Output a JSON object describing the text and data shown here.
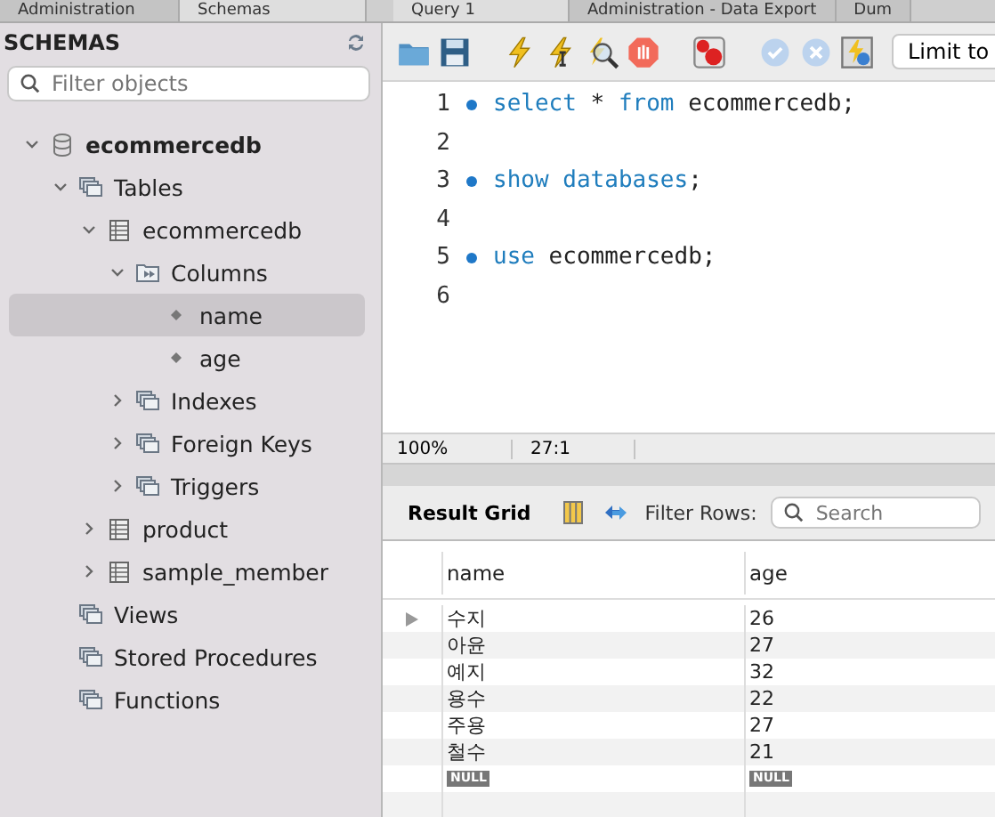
{
  "top_tabs": [
    {
      "label": "Administration",
      "selected": false
    },
    {
      "label": "Schemas",
      "selected": true
    },
    {
      "label": "Query 1",
      "selected": true
    },
    {
      "label": "Administration - Data Export",
      "selected": false
    },
    {
      "label": "Dum",
      "selected": false
    }
  ],
  "sidebar": {
    "title": "SCHEMAS",
    "filter": {
      "placeholder": "Filter objects"
    },
    "tree": [
      {
        "label": "ecommercedb",
        "kind": "database",
        "expanded": true,
        "selected": false,
        "children": [
          {
            "label": "Tables",
            "kind": "folder",
            "expanded": true,
            "selected": false,
            "children": [
              {
                "label": "ecommercedb",
                "kind": "table",
                "expanded": true,
                "selected": false,
                "children": [
                  {
                    "label": "Columns",
                    "kind": "columns",
                    "expanded": true,
                    "selected": false,
                    "children": [
                      {
                        "label": "name",
                        "kind": "column",
                        "selected": true
                      },
                      {
                        "label": "age",
                        "kind": "column",
                        "selected": false
                      }
                    ]
                  },
                  {
                    "label": "Indexes",
                    "kind": "folder",
                    "expanded": false,
                    "selected": false
                  },
                  {
                    "label": "Foreign Keys",
                    "kind": "folder",
                    "expanded": false,
                    "selected": false
                  },
                  {
                    "label": "Triggers",
                    "kind": "folder",
                    "expanded": false,
                    "selected": false
                  }
                ]
              },
              {
                "label": "product",
                "kind": "table",
                "expanded": false,
                "selected": false
              },
              {
                "label": "sample_member",
                "kind": "table",
                "expanded": false,
                "selected": false
              }
            ]
          },
          {
            "label": "Views",
            "kind": "folder",
            "selected": false
          },
          {
            "label": "Stored Procedures",
            "kind": "folder",
            "selected": false
          },
          {
            "label": "Functions",
            "kind": "folder",
            "selected": false
          }
        ]
      }
    ]
  },
  "toolbar": {
    "limit": "Limit to"
  },
  "editor": {
    "lines": [
      {
        "number": "1",
        "marker": true,
        "tokens": [
          {
            "text": "select",
            "kind": "keyword"
          },
          {
            "text": " * ",
            "kind": "plain"
          },
          {
            "text": "from",
            "kind": "keyword"
          },
          {
            "text": " ecommercedb;",
            "kind": "plain"
          }
        ]
      },
      {
        "number": "2",
        "marker": false
      },
      {
        "number": "3",
        "marker": true,
        "tokens": [
          {
            "text": "show",
            "kind": "keyword"
          },
          {
            "text": " databases",
            "kind": "keyword"
          },
          {
            "text": ";",
            "kind": "plain"
          }
        ]
      },
      {
        "number": "4",
        "marker": false
      },
      {
        "number": "5",
        "marker": true,
        "tokens": [
          {
            "text": "use",
            "kind": "keyword"
          },
          {
            "text": " ecommercedb;",
            "kind": "plain"
          }
        ]
      },
      {
        "number": "6",
        "marker": false
      }
    ]
  },
  "status": {
    "zoom": "100%",
    "position": "27:1"
  },
  "result": {
    "title": "Result Grid",
    "filter_label": "Filter Rows:",
    "search": {
      "placeholder": "Search"
    },
    "columns": [
      "name",
      "age"
    ],
    "rows": [
      {
        "cells": [
          "수지",
          "26"
        ],
        "current": true,
        "null": false
      },
      {
        "cells": [
          "아윤",
          "27"
        ],
        "current": false,
        "null": false
      },
      {
        "cells": [
          "예지",
          "32"
        ],
        "current": false,
        "null": false
      },
      {
        "cells": [
          "용수",
          "22"
        ],
        "current": false,
        "null": false
      },
      {
        "cells": [
          "주용",
          "27"
        ],
        "current": false,
        "null": false
      },
      {
        "cells": [
          "철수",
          "21"
        ],
        "current": false,
        "null": false
      },
      {
        "cells": [
          "NULL",
          "NULL"
        ],
        "current": false,
        "null": true
      }
    ]
  }
}
